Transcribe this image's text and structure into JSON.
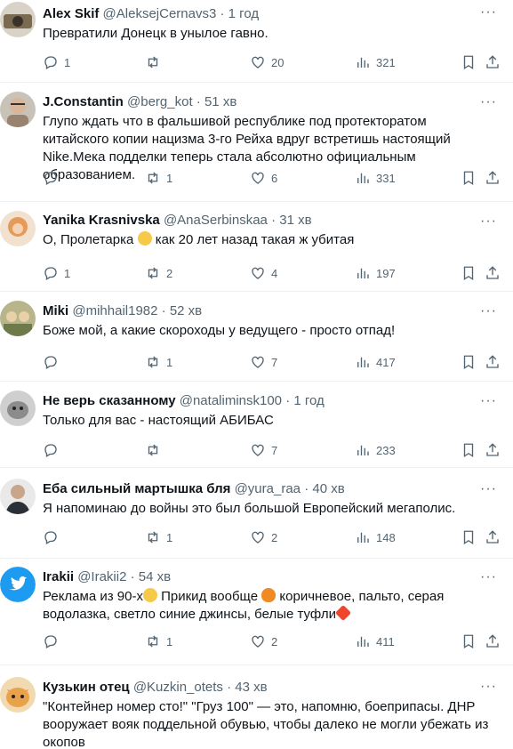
{
  "tweets": [
    {
      "name": "Alex Skif",
      "handle": "@AleksejCernavs3",
      "dot": "·",
      "time": "1 год",
      "text": "Превратили Донецк в унылое гавно.",
      "replies": "1",
      "retweets": "",
      "likes": "20",
      "views": "321",
      "avatar_color": "#7b6a52"
    },
    {
      "name": "J.Constantin",
      "handle": "@berg_kot",
      "dot": "·",
      "time": "51 хв",
      "text": "Глупо ждать что в фальшивой республике под протекторатом китайского копии нацизма 3-го Рейха вдруг встретишь настоящий Nike.Мека подделки теперь стала абсолютно официальным образованием.",
      "replies": "",
      "retweets": "1",
      "likes": "6",
      "views": "331",
      "avatar_color": "#9a8270"
    },
    {
      "name": "Yanika Krasnivska",
      "handle": "@AnaSerbinskaa",
      "dot": "·",
      "time": "31 хв",
      "text_before": "О, Пролетарка ",
      "text_after": " как 20 лет назад такая ж убитая",
      "replies": "1",
      "retweets": "2",
      "likes": "4",
      "views": "197",
      "avatar_color": "#e39a5a"
    },
    {
      "name": "Miki",
      "handle": "@mihhail1982",
      "dot": "·",
      "time": "52 хв",
      "text": "Боже мой, а какие скороходы у ведущего - просто отпад!",
      "replies": "",
      "retweets": "1",
      "likes": "7",
      "views": "417",
      "avatar_color": "#6e7a4a"
    },
    {
      "name": "Не верь сказанному",
      "handle": "@nataliminsk100",
      "dot": "·",
      "time": "1 год",
      "text": "Только для вас - настоящий АБИБАС",
      "replies": "",
      "retweets": "",
      "likes": "7",
      "views": "233",
      "avatar_color": "#8c8c8c"
    },
    {
      "name": "Еба сильный мартышка бля",
      "handle": "@yura_raa",
      "dot": "·",
      "time": "40 хв",
      "text": "Я напоминаю до войны это был большой Европейский мегаполис.",
      "replies": "",
      "retweets": "1",
      "likes": "2",
      "views": "148",
      "avatar_color": "#2b2f36"
    },
    {
      "name": "Irakii",
      "handle": "@Irakii2",
      "dot": "·",
      "time": "54 хв",
      "text_line1_before": "Реклама из 90-х",
      "text_line1_after": " Прикид вообще ",
      "text_line1_tail": " коричневое, пальто, серая",
      "text_line2": "водолазка, светло синие джинсы, белые туфли",
      "replies": "",
      "retweets": "1",
      "likes": "2",
      "views": "411",
      "avatar_color": "#1d9bf0"
    },
    {
      "name": "Кузькин отец",
      "handle": "@Kuzkin_otets",
      "dot": "·",
      "time": "43 хв",
      "text": "\"Контейнер номер сто!\" \"Груз 100\" — это, напомню, боеприпасы. ДНР вооружает вояк поддельной обувью, чтобы далеко не могли убежать из окопов",
      "avatar_color": "#e8a24a"
    }
  ],
  "ui": {
    "more_glyph": "···",
    "accent": "#1d9bf0",
    "muted": "#536471"
  }
}
